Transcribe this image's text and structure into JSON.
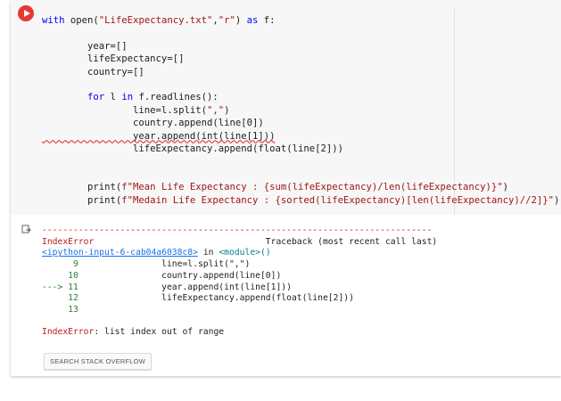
{
  "cell": {
    "code_lines": [
      "with open(\"LifeExpectancy.txt\",\"r\") as f:",
      "",
      "        year=[]",
      "        lifeExpectancy=[]",
      "        country=[]",
      "",
      "        for l in f.readlines():",
      "                line=l.split(\",\")",
      "                country.append(line[0])",
      "                year.append(int(line[1]))",
      "                lifeExpectancy.append(float(line[2]))",
      "",
      "",
      "        print(f\"Mean Life Expectancy : {sum(lifeExpectancy)/len(lifeExpectancy)}\")",
      "        print(f\"Medain Life Expectancy : {sorted(lifeExpectancy)[len(lifeExpectancy)//2]}\")"
    ]
  },
  "output": {
    "separator": "---------------------------------------------------------------------------",
    "error_type": "IndexError",
    "traceback_label": "Traceback (most recent call last)",
    "input_link": "<ipython-input-6-cab04a6038c8>",
    "in_text": " in ",
    "module": "<module>()",
    "trace_lines": [
      {
        "num": "      9",
        "code": "                line=l.split(\",\")"
      },
      {
        "num": "     10",
        "code": "                country.append(line[0])"
      },
      {
        "num": "---> 11",
        "code": "                year.append(int(line[1]))"
      },
      {
        "num": "     12",
        "code": "                lifeExpectancy.append(float(line[2]))"
      },
      {
        "num": "     13",
        "code": ""
      }
    ],
    "error_message": ": list index out of range"
  },
  "buttons": {
    "stack_overflow": "SEARCH STACK OVERFLOW"
  },
  "colors": {
    "run": "#e53935",
    "error": "#b71c1c",
    "link": "#1a73e8"
  }
}
